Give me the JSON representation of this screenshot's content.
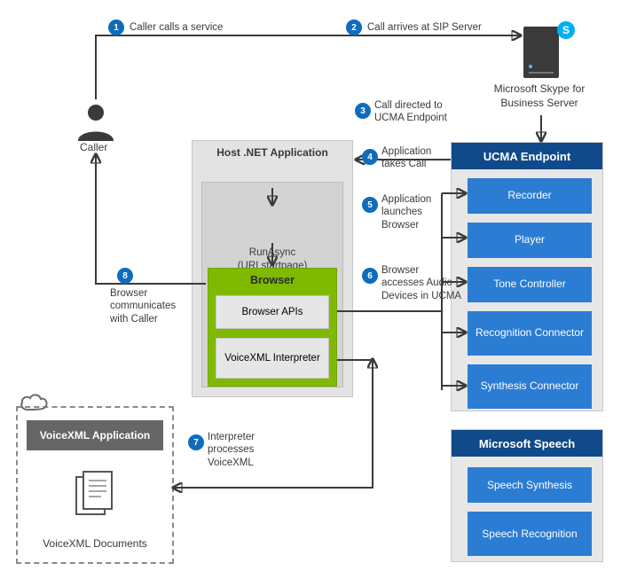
{
  "caller": {
    "label": "Caller"
  },
  "server": {
    "label": "Microsoft Skype for Business Server",
    "skype_glyph": "S"
  },
  "host": {
    "title": "Host .NET Application",
    "run_line1": "RunAsync",
    "run_line2": "(URI startpage)"
  },
  "browser": {
    "title": "Browser",
    "apis": "Browser APIs",
    "interpreter": "VoiceXML Interpreter"
  },
  "ucma": {
    "header": "UCMA Endpoint",
    "items": [
      "Recorder",
      "Player",
      "Tone Controller",
      "Recognition Connector",
      "Synthesis Connector"
    ]
  },
  "mspeech": {
    "header": "Microsoft Speech",
    "items": [
      "Speech Synthesis",
      "Speech Recognition"
    ]
  },
  "vxml_app": {
    "title": "VoiceXML Application",
    "docs": "VoiceXML Documents"
  },
  "steps": [
    {
      "n": "1",
      "text": "Caller calls a service"
    },
    {
      "n": "2",
      "text": "Call arrives at SIP Server"
    },
    {
      "n": "3",
      "text": "Call directed to UCMA Endpoint"
    },
    {
      "n": "4",
      "text": "Application takes Call"
    },
    {
      "n": "5",
      "text": "Application launches Browser"
    },
    {
      "n": "6",
      "text": "Browser accesses Audio Devices in UCMA"
    },
    {
      "n": "7",
      "text": "Interpreter processes VoiceXML"
    },
    {
      "n": "8",
      "text": "Browser communicates with Caller"
    }
  ]
}
